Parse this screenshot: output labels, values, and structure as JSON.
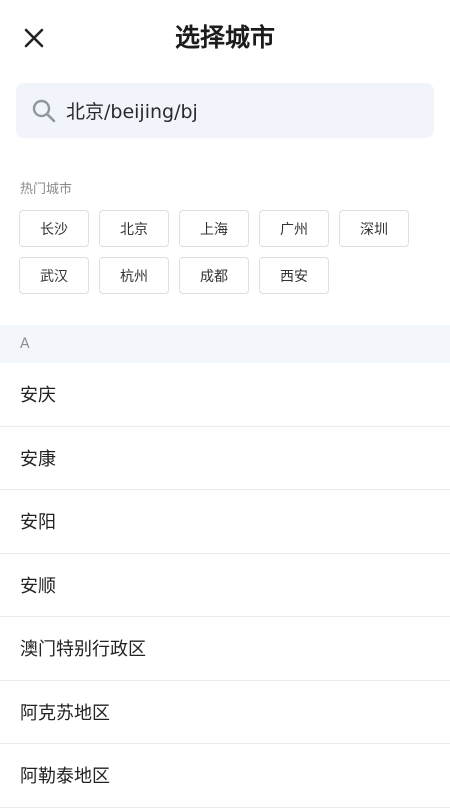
{
  "header": {
    "title": "选择城市",
    "close_icon": "close-icon"
  },
  "search": {
    "value": "北京/beijing/bj",
    "icon": "search-icon"
  },
  "hot": {
    "title": "热门城市",
    "cities": [
      "长沙",
      "北京",
      "上海",
      "广州",
      "深圳",
      "武汉",
      "杭州",
      "成都",
      "西安"
    ]
  },
  "section": {
    "letter": "A"
  },
  "cities": [
    "安庆",
    "安康",
    "安阳",
    "安顺",
    "澳门特别行政区",
    "阿克苏地区",
    "阿勒泰地区"
  ]
}
